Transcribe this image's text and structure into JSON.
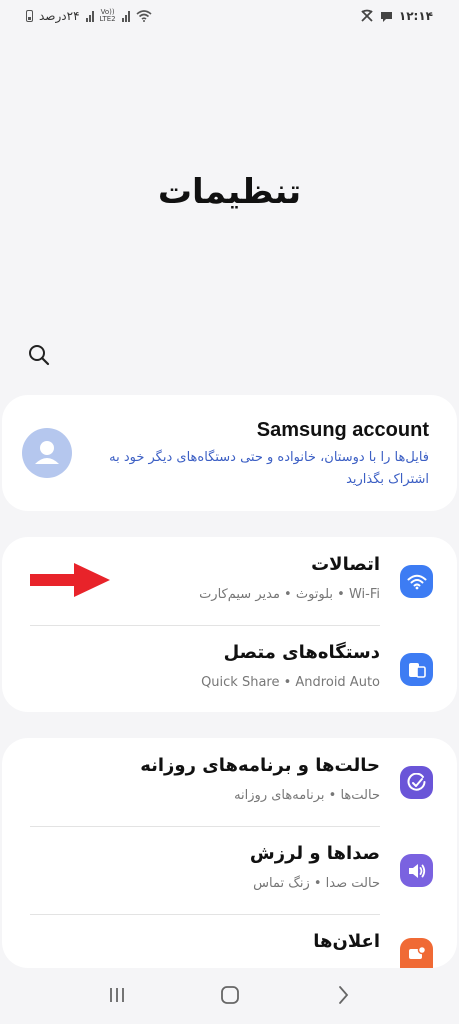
{
  "status_bar": {
    "time": "۱۲:۱۴",
    "battery_text": "۲۴درصد",
    "network_label": "Vo))\nLTE2"
  },
  "header": {
    "title": "تنظیمات"
  },
  "account": {
    "title": "Samsung account",
    "subtitle": "فایل‌ها را با دوستان، خانواده و حتی دستگاه‌های دیگر خود به اشتراک بگذارید"
  },
  "sections": [
    {
      "items": [
        {
          "id": "connections",
          "title": "اتصالات",
          "subtitle": "Wi-Fi  •  بلوتوث  •  مدیر سیم‌کارت",
          "icon": "wifi-icon",
          "color": "#3d7cf3"
        },
        {
          "id": "connected-devices",
          "title": "دستگاه‌های متصل",
          "subtitle": "Quick Share  •  Android Auto",
          "icon": "devices-icon",
          "color": "#3d7cf3"
        }
      ]
    },
    {
      "items": [
        {
          "id": "modes",
          "title": "حالت‌ها و برنامه‌های روزانه",
          "subtitle": "حالت‌ها  •  برنامه‌های روزانه",
          "icon": "check-circle-icon",
          "color": "#6a55d8"
        },
        {
          "id": "sounds",
          "title": "صداها و لرزش",
          "subtitle": "حالت صدا  •  زنگ تماس",
          "icon": "speaker-icon",
          "color": "#7a62e0"
        },
        {
          "id": "notifications",
          "title": "اعلان‌ها",
          "subtitle": "",
          "icon": "notification-icon",
          "color": "#f06a35"
        }
      ]
    }
  ],
  "colors": {
    "accent_blue": "#3d7cf3",
    "link_blue": "#3c5fc4",
    "arrow_red": "#e8232a",
    "background": "#f5f5f7"
  }
}
